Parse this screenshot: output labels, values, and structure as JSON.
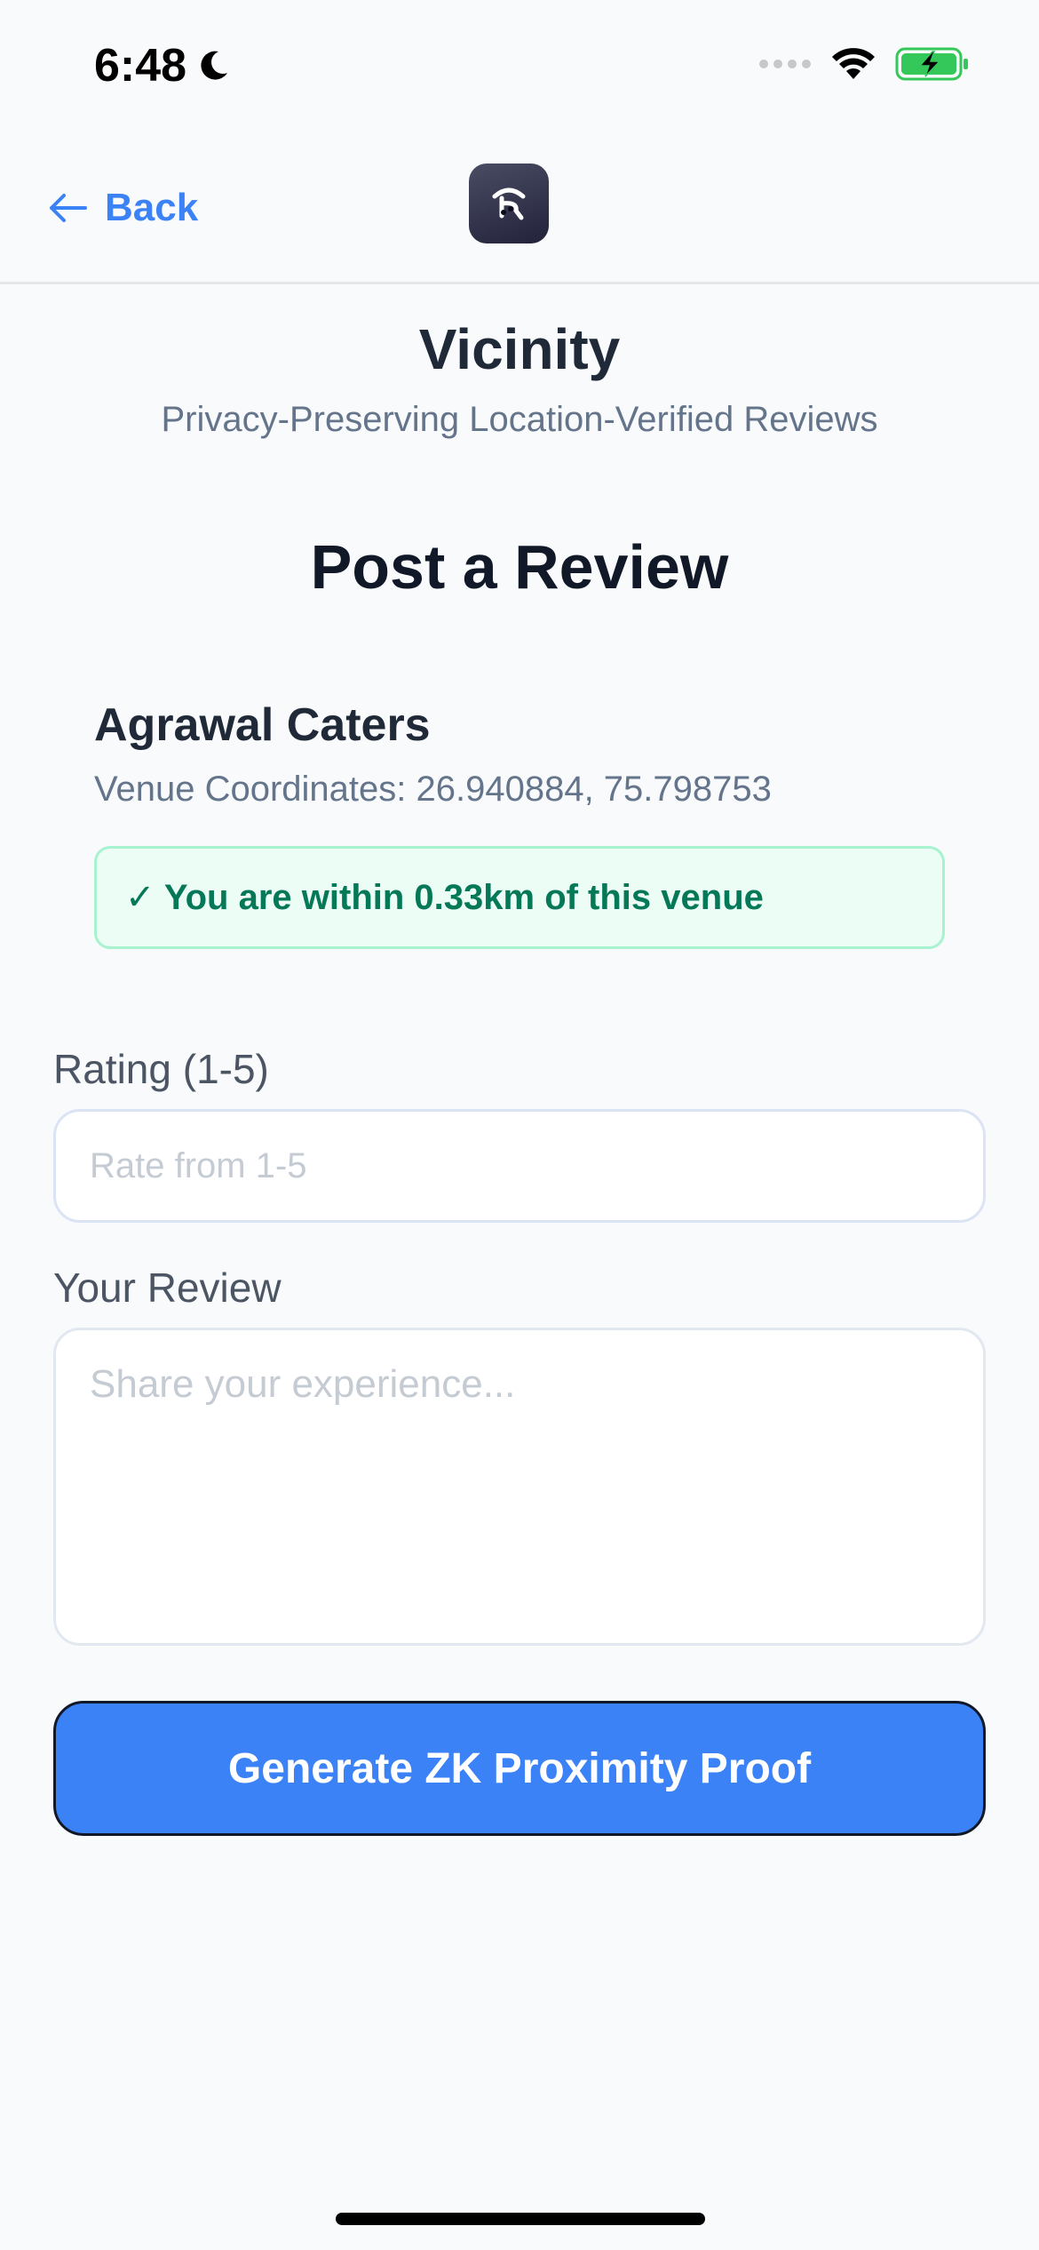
{
  "status_bar": {
    "time": "6:48",
    "icons": [
      "moon-icon",
      "signal-icon",
      "wifi-icon",
      "battery-charging-icon"
    ],
    "battery_color": "#34c759"
  },
  "header": {
    "back_label": "Back",
    "logo_icon": "app-logo-icon"
  },
  "brand": {
    "title": "Vicinity",
    "subtitle": "Privacy-Preserving Location-Verified Reviews"
  },
  "page": {
    "title": "Post a Review"
  },
  "venue": {
    "name": "Agrawal Caters",
    "coordinates": "Venue Coordinates: 26.940884, 75.798753",
    "proximity_text": "✓ You are within 0.33km of this venue"
  },
  "form": {
    "rating_label": "Rating (1-5)",
    "rating_value": "",
    "rating_placeholder": "Rate from 1-5",
    "review_label": "Your Review",
    "review_value": "",
    "review_placeholder": "Share your experience...",
    "submit_label": "Generate ZK Proximity Proof"
  },
  "colors": {
    "accent": "#3b82f6",
    "success_text": "#047857",
    "success_bg": "#ecfdf5",
    "background": "#f8fafc"
  }
}
